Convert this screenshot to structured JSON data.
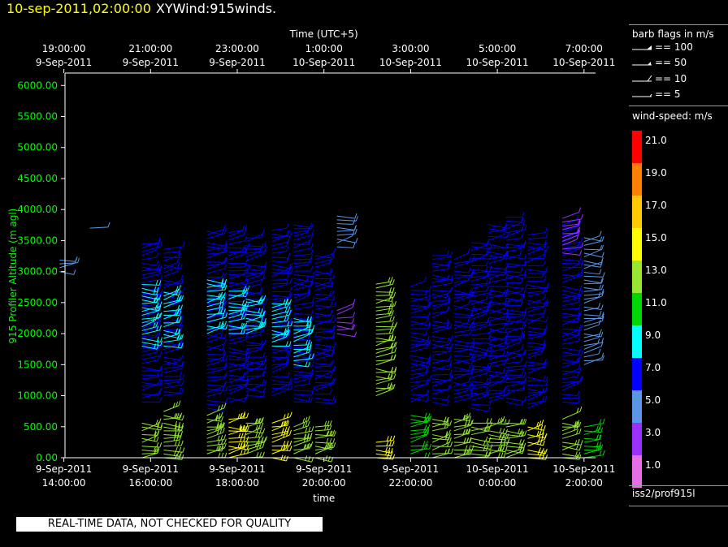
{
  "header": {
    "datetime": "10-sep-2011,02:00:00",
    "title": "XYWind:915winds."
  },
  "legend": {
    "barb_title": "barb flags in m/s",
    "barbs": [
      {
        "value": 100,
        "label": "== 100"
      },
      {
        "value": 50,
        "label": "== 50"
      },
      {
        "value": 10,
        "label": "== 10"
      },
      {
        "value": 5,
        "label": "== 5"
      }
    ],
    "speed_title": "wind-speed: m/s",
    "speed_levels": [
      {
        "label": "21.0",
        "color": "#ff0000"
      },
      {
        "label": "19.0",
        "color": "#ff7f00"
      },
      {
        "label": "17.0",
        "color": "#ffc800"
      },
      {
        "label": "15.0",
        "color": "#ffff00"
      },
      {
        "label": "13.0",
        "color": "#96e632"
      },
      {
        "label": "11.0",
        "color": "#00d700"
      },
      {
        "label": "9.0",
        "color": "#00ffff"
      },
      {
        "label": "7.0",
        "color": "#0000ff"
      },
      {
        "label": "5.0",
        "color": "#5a96e6"
      },
      {
        "label": "3.0",
        "color": "#9b30ff"
      },
      {
        "label": "1.0",
        "color": "#e66ee6"
      }
    ],
    "source": "iss2/prof915l"
  },
  "disclaimer": "REAL-TIME DATA, NOT CHECKED FOR QUALITY",
  "chart_data": {
    "type": "scatter",
    "variant": "wind-barb time-height section",
    "ylabel": "915 Profiler Altitude (m agl)",
    "xlabel": "time",
    "top_axis_label": "Time (UTC+5)",
    "ylim": [
      0,
      6200
    ],
    "y_ticks": [
      "0.00",
      "500.00",
      "1000.00",
      "1500.00",
      "2000.00",
      "2500.00",
      "3000.00",
      "3500.00",
      "4000.00",
      "4500.00",
      "5000.00",
      "5500.00",
      "6000.00"
    ],
    "xlim_hours": [
      13.5,
      27
    ],
    "bottom_ticks": [
      {
        "hour": 14,
        "line1": "9-Sep-2011",
        "line2": "14:00:00"
      },
      {
        "hour": 16,
        "line1": "9-Sep-2011",
        "line2": "16:00:00"
      },
      {
        "hour": 18,
        "line1": "9-Sep-2011",
        "line2": "18:00:00"
      },
      {
        "hour": 20,
        "line1": "9-Sep-2011",
        "line2": "20:00:00"
      },
      {
        "hour": 22,
        "line1": "9-Sep-2011",
        "line2": "22:00:00"
      },
      {
        "hour": 24,
        "line1": "10-Sep-2011",
        "line2": "0:00:00"
      },
      {
        "hour": 26,
        "line1": "10-Sep-2011",
        "line2": "2:00:00"
      }
    ],
    "top_ticks": [
      {
        "hour": 14,
        "line1": "19:00:00",
        "line2": "9-Sep-2011"
      },
      {
        "hour": 16,
        "line1": "21:00:00",
        "line2": "9-Sep-2011"
      },
      {
        "hour": 18,
        "line1": "23:00:00",
        "line2": "9-Sep-2011"
      },
      {
        "hour": 20,
        "line1": "1:00:00",
        "line2": "10-Sep-2011"
      },
      {
        "hour": 22,
        "line1": "3:00:00",
        "line2": "10-Sep-2011"
      },
      {
        "hour": 24,
        "line1": "5:00:00",
        "line2": "10-Sep-2011"
      },
      {
        "hour": 26,
        "line1": "7:00:00",
        "line2": "10-Sep-2011"
      }
    ],
    "grid": false,
    "speed_colors": [
      "#e66ee6",
      "#9b30ff",
      "#5a96e6",
      "#0000ff",
      "#00ffff",
      "#00d700",
      "#96e632",
      "#ffff00",
      "#ffc800",
      "#ff7f00",
      "#ff0000"
    ],
    "speed_bin_edges": [
      0,
      2,
      4,
      6,
      8,
      10,
      12,
      14,
      16,
      18,
      20
    ],
    "profiles": [
      {
        "hour": 13.9,
        "segments": [
          [
            3000,
            3200,
            4
          ]
        ]
      },
      {
        "hour": 14.6,
        "segments": [
          [
            3700,
            3760,
            5
          ]
        ]
      },
      {
        "hour": 15.8,
        "segments": [
          [
            900,
            3450,
            7
          ],
          [
            1800,
            2800,
            9
          ],
          [
            0,
            600,
            12
          ]
        ]
      },
      {
        "hour": 16.3,
        "segments": [
          [
            1000,
            3400,
            7
          ],
          [
            1800,
            2700,
            9
          ],
          [
            0,
            750,
            13
          ]
        ]
      },
      {
        "hour": 17.3,
        "segments": [
          [
            800,
            3700,
            7
          ],
          [
            2000,
            2900,
            9
          ],
          [
            0,
            700,
            13
          ]
        ]
      },
      {
        "hour": 17.8,
        "segments": [
          [
            900,
            3650,
            7
          ],
          [
            2000,
            2700,
            9
          ],
          [
            0,
            650,
            14
          ]
        ]
      },
      {
        "hour": 18.2,
        "segments": [
          [
            1000,
            3600,
            7
          ],
          [
            2000,
            2600,
            9
          ],
          [
            0,
            600,
            13
          ]
        ]
      },
      {
        "hour": 18.8,
        "segments": [
          [
            1000,
            3700,
            7
          ],
          [
            1800,
            2500,
            9
          ],
          [
            0,
            600,
            14
          ]
        ]
      },
      {
        "hour": 19.3,
        "segments": [
          [
            900,
            3800,
            7
          ],
          [
            1500,
            2300,
            9
          ],
          [
            0,
            550,
            13
          ]
        ]
      },
      {
        "hour": 19.8,
        "segments": [
          [
            900,
            3300,
            6
          ],
          [
            0,
            500,
            13
          ]
        ]
      },
      {
        "hour": 20.3,
        "segments": [
          [
            3400,
            3900,
            5
          ],
          [
            2000,
            2400,
            3
          ]
        ]
      },
      {
        "hour": 21.2,
        "segments": [
          [
            1000,
            2800,
            12
          ],
          [
            0,
            300,
            14
          ]
        ]
      },
      {
        "hour": 22.0,
        "segments": [
          [
            900,
            2800,
            7
          ],
          [
            0,
            700,
            11
          ]
        ]
      },
      {
        "hour": 22.5,
        "segments": [
          [
            900,
            3300,
            7
          ],
          [
            0,
            650,
            12
          ]
        ]
      },
      {
        "hour": 23.0,
        "segments": [
          [
            900,
            3200,
            7
          ],
          [
            0,
            650,
            13
          ]
        ]
      },
      {
        "hour": 23.4,
        "segments": [
          [
            800,
            3500,
            7
          ],
          [
            0,
            600,
            12
          ]
        ]
      },
      {
        "hour": 23.8,
        "segments": [
          [
            900,
            3800,
            7
          ],
          [
            0,
            600,
            13
          ]
        ]
      },
      {
        "hour": 24.2,
        "segments": [
          [
            900,
            3900,
            7
          ],
          [
            0,
            600,
            12
          ]
        ]
      },
      {
        "hour": 24.7,
        "segments": [
          [
            800,
            3600,
            7
          ],
          [
            0,
            550,
            14
          ]
        ]
      },
      {
        "hour": 25.5,
        "segments": [
          [
            900,
            3800,
            6
          ],
          [
            3300,
            3900,
            3
          ],
          [
            0,
            650,
            12
          ]
        ]
      },
      {
        "hour": 26.0,
        "segments": [
          [
            1500,
            3600,
            5
          ],
          [
            0,
            500,
            10
          ]
        ]
      }
    ]
  }
}
